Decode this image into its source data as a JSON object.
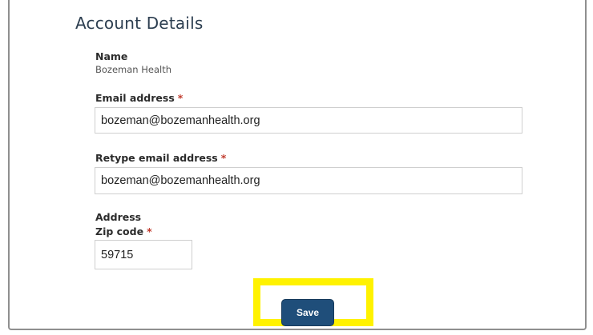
{
  "account": {
    "title": "Account Details",
    "name_label": "Name",
    "name_value": "Bozeman Health",
    "email_label": "Email address",
    "email_value": "bozeman@bozemanhealth.org",
    "retype_email_label": "Retype email address",
    "retype_email_value": "bozeman@bozemanhealth.org",
    "address_label": "Address",
    "zip_label": "Zip code",
    "zip_value": "59715",
    "required_marker": "*",
    "save_label": "Save"
  },
  "colors": {
    "button": "#1f4e7a",
    "highlight": "#fff200",
    "required": "#c0392b",
    "title": "#2c3e50"
  }
}
